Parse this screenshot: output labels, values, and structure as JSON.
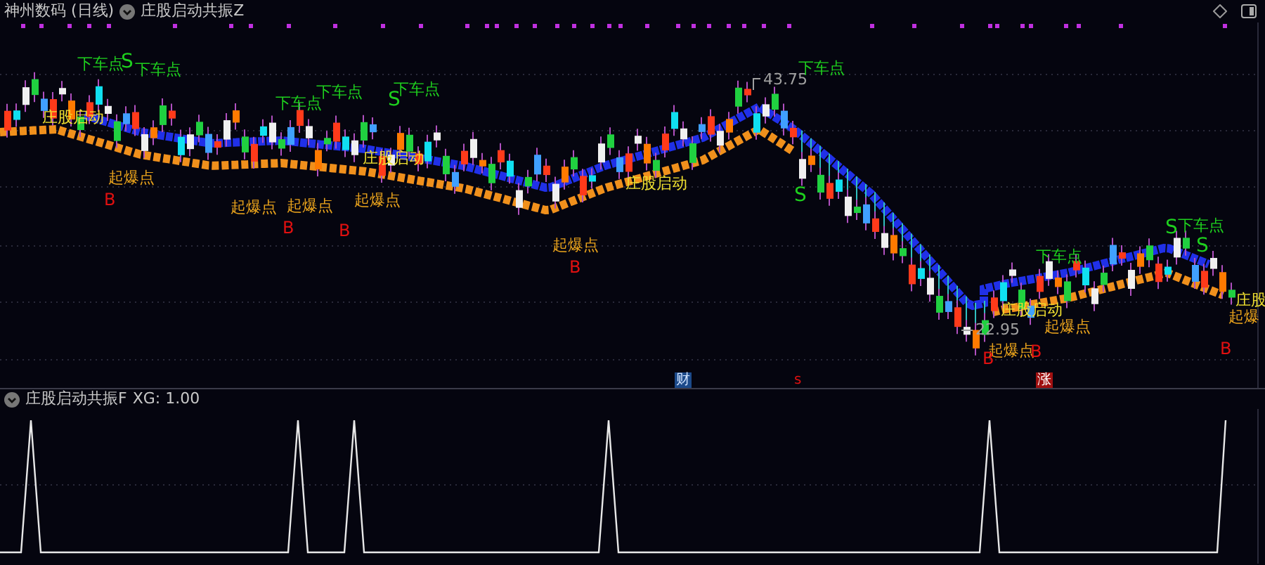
{
  "header": {
    "stock": "神州数码 (日线)",
    "indicator": "庄股启动共振Z"
  },
  "chart_labels": [
    {
      "kind": "sell",
      "text": "下车点"
    },
    {
      "kind": "sell",
      "text": "S"
    },
    {
      "kind": "sell",
      "text": "下车点"
    },
    {
      "kind": "start",
      "text": "庄股启动"
    },
    {
      "kind": "sell",
      "text": "下车点"
    },
    {
      "kind": "sell",
      "text": "下车点"
    },
    {
      "kind": "sell",
      "text": "S"
    },
    {
      "kind": "sell",
      "text": "下车点"
    },
    {
      "kind": "start",
      "text": "庄股启动"
    },
    {
      "kind": "burst",
      "text": "起爆点"
    },
    {
      "kind": "buy",
      "text": "B"
    },
    {
      "kind": "burst",
      "text": "起爆点"
    },
    {
      "kind": "burst",
      "text": "起爆点"
    },
    {
      "kind": "burst",
      "text": "起爆点"
    },
    {
      "kind": "buy",
      "text": "B"
    },
    {
      "kind": "buy",
      "text": "B"
    },
    {
      "kind": "start",
      "text": "庄股启动"
    },
    {
      "kind": "burst",
      "text": "起爆点"
    },
    {
      "kind": "buy",
      "text": "B"
    },
    {
      "kind": "price",
      "text": "43.75"
    },
    {
      "kind": "sell",
      "text": "下车点"
    },
    {
      "kind": "sell",
      "text": "S"
    },
    {
      "kind": "sell",
      "text": "下车点"
    },
    {
      "kind": "sell",
      "text": "S"
    },
    {
      "kind": "sell",
      "text": "下车点"
    },
    {
      "kind": "sell",
      "text": "S"
    },
    {
      "kind": "start",
      "text": "庄股启动"
    },
    {
      "kind": "price",
      "text": "22.95"
    },
    {
      "kind": "burst",
      "text": "起爆点"
    },
    {
      "kind": "burst",
      "text": "起爆点"
    },
    {
      "kind": "buy",
      "text": "B"
    },
    {
      "kind": "buy",
      "text": "B"
    },
    {
      "kind": "start",
      "text": "庄股"
    },
    {
      "kind": "burst",
      "text": "起爆"
    },
    {
      "kind": "buy",
      "text": "B"
    }
  ],
  "event_markers": [
    {
      "kind": "finance",
      "text": "财"
    },
    {
      "kind": "signal",
      "text": "s"
    },
    {
      "kind": "rise",
      "text": "涨"
    }
  ],
  "sub_panel": {
    "indicator": "庄股启动共振F",
    "reading": "XG: 1.00"
  }
}
